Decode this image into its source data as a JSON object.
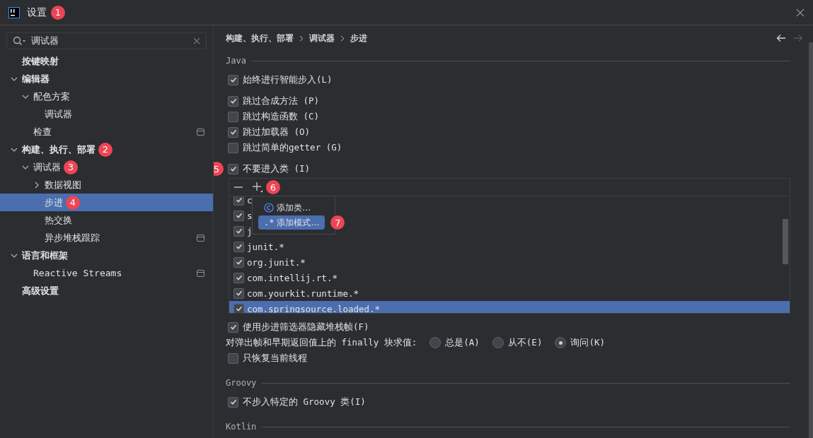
{
  "window": {
    "title": "设置",
    "badge": "1"
  },
  "search": {
    "value": "调试器"
  },
  "tree": [
    {
      "label": "按键映射",
      "selected": false
    },
    {
      "label": "编辑器",
      "expanded": true,
      "selected": false,
      "children": [
        {
          "label": "配色方案",
          "expanded": true,
          "selected": false,
          "children": [
            {
              "label": "调试器",
              "selected": false
            }
          ]
        },
        {
          "label": "检查",
          "selected": false,
          "scope_icon": true
        }
      ]
    },
    {
      "label": "构建、执行、部署",
      "expanded": true,
      "selected": false,
      "badge": "2",
      "children": [
        {
          "label": "调试器",
          "expanded": true,
          "selected": false,
          "badge": "3",
          "children": [
            {
              "label": "数据视图",
              "expanded": false,
              "selected": false
            },
            {
              "label": "步进",
              "selected": true,
              "badge": "4"
            },
            {
              "label": "热交换",
              "selected": false
            },
            {
              "label": "异步堆栈跟踪",
              "selected": false,
              "scope_icon": true
            }
          ]
        }
      ]
    },
    {
      "label": "语言和框架",
      "expanded": true,
      "selected": false,
      "children": [
        {
          "label": "Reactive Streams",
          "selected": false,
          "scope_icon": true
        }
      ]
    },
    {
      "label": "高级设置",
      "selected": false
    }
  ],
  "breadcrumb": [
    "构建、执行、部署",
    "调试器",
    "步进"
  ],
  "sections": [
    {
      "title": "Java",
      "groups": [
        [
          {
            "kind": "checkbox",
            "label": "始终进行智能步入(L)",
            "checked": true
          }
        ],
        [
          {
            "kind": "checkbox",
            "label": "跳过合成方法 (P)",
            "checked": true
          },
          {
            "kind": "checkbox",
            "label": "跳过构造函数 (C)",
            "checked": false
          },
          {
            "kind": "checkbox",
            "label": "跳过加载器 (O)",
            "checked": true
          },
          {
            "kind": "checkbox",
            "label": "跳过简单的getter (G)",
            "checked": false
          }
        ],
        [
          {
            "kind": "checkbox",
            "label": "不要进入类 (I)",
            "checked": true,
            "badge": "5"
          },
          {
            "kind": "filter_list",
            "add_badge": "6",
            "rows": [
              {
                "text": "c",
                "checked": true,
                "selected": false
              },
              {
                "text": "s",
                "checked": true,
                "selected": false
              },
              {
                "text": "j",
                "checked": true,
                "selected": false
              },
              {
                "text": "junit.*",
                "checked": true,
                "selected": false
              },
              {
                "text": "org.junit.*",
                "checked": true,
                "selected": false
              },
              {
                "text": "com.intellij.rt.*",
                "checked": true,
                "selected": false
              },
              {
                "text": "com.yourkit.runtime.*",
                "checked": true,
                "selected": false
              },
              {
                "text": "com.springsource.loaded.*",
                "checked": true,
                "selected": true
              }
            ],
            "popup": [
              {
                "kind": "class",
                "label": "添加类…",
                "selected": false
              },
              {
                "kind": "pattern",
                "prefix": ".*",
                "label": "添加模式…",
                "selected": true,
                "badge": "7"
              }
            ]
          },
          {
            "kind": "checkbox",
            "label": "使用步进筛选器隐藏堆栈帧(F)",
            "checked": true
          },
          {
            "kind": "radio_group",
            "label": "对弹出帧和早期返回值上的 finally 块求值:",
            "options": [
              {
                "label": "总是(A)",
                "selected": false
              },
              {
                "label": "从不(E)",
                "selected": false
              },
              {
                "label": "询问(K)",
                "selected": true
              }
            ]
          },
          {
            "kind": "checkbox",
            "label": "只恢复当前线程",
            "checked": false
          }
        ]
      ]
    },
    {
      "title": "Groovy",
      "groups": [
        [
          {
            "kind": "checkbox",
            "label": "不步入特定的 Groovy 类(I)",
            "checked": true
          }
        ]
      ]
    },
    {
      "title": "Kotlin"
    }
  ]
}
